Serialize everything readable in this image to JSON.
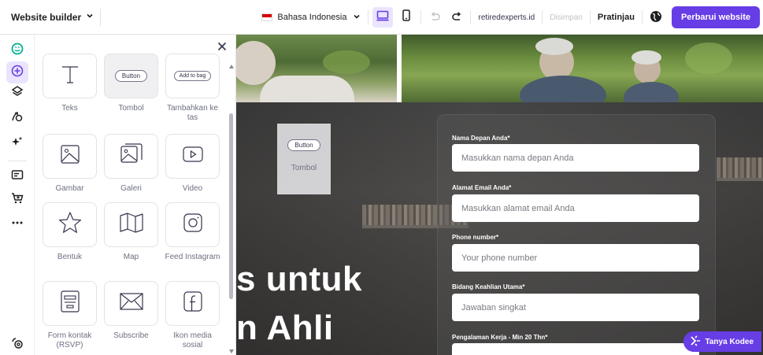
{
  "topbar": {
    "brand": "Website builder",
    "language": "Bahasa Indonesia",
    "domain": "retiredexperts.id",
    "saved": "Disimpan",
    "preview": "Pratinjau",
    "update": "Perbarui website"
  },
  "rail": {
    "icons": [
      "logo-icon",
      "add-elements-icon",
      "layers-icon",
      "design-icon",
      "ai-tools-icon",
      "blog-icon",
      "store-icon",
      "more-icon",
      "help-icon"
    ]
  },
  "panel": {
    "tiles": [
      {
        "label": "Teks"
      },
      {
        "label": "Tombol",
        "preview": "Button"
      },
      {
        "label": "Tambahkan ke tas",
        "preview": "Add to bag"
      },
      {
        "label": "Gambar"
      },
      {
        "label": "Galeri"
      },
      {
        "label": "Video"
      },
      {
        "label": "Bentuk"
      },
      {
        "label": "Map"
      },
      {
        "label": "Feed Instagram"
      },
      {
        "label": "Form kontak (RSVP)"
      },
      {
        "label": "Subscribe"
      },
      {
        "label": "Ikon media sosial"
      }
    ]
  },
  "canvas": {
    "hero_line1": "s untuk",
    "hero_line2": "n Ahli",
    "drag_preview": "Button",
    "drag_label": "Tombol",
    "form": {
      "fields": [
        {
          "label": "Nama Depan Anda*",
          "placeholder": "Masukkan nama depan Anda"
        },
        {
          "label": "Alamat Email Anda*",
          "placeholder": "Masukkan alamat email Anda"
        },
        {
          "label": "Phone number*",
          "placeholder": "Your phone number"
        },
        {
          "label": "Bidang Keahlian Utama*",
          "placeholder": "Jawaban singkat"
        },
        {
          "label": "Pengalaman Kerja - Min 20 Thn*",
          "placeholder": ""
        }
      ]
    },
    "chat_button": "Tanya Kodee"
  },
  "colors": {
    "accent": "#673de6",
    "accent_light": "#ebe4ff"
  }
}
